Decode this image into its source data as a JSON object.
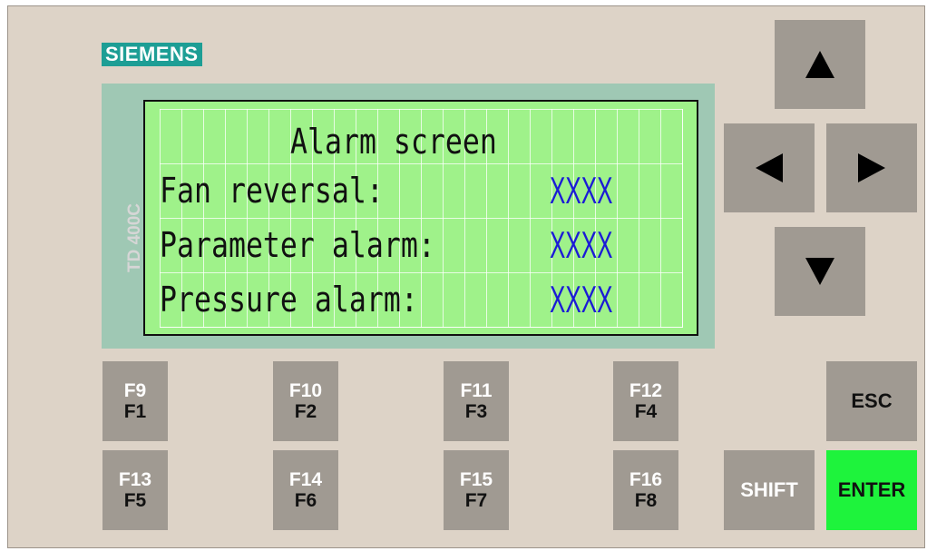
{
  "brand": "SIEMENS",
  "model": "TD 400C",
  "lcd": {
    "title": "Alarm screen",
    "rows": [
      {
        "label": "Fan reversal:",
        "value": "XXXX"
      },
      {
        "label": "Parameter alarm:",
        "value": "XXXX"
      },
      {
        "label": "Pressure alarm:",
        "value": "XXXX"
      }
    ],
    "colors": {
      "background": "#9ff28a",
      "value_text": "#1b1bd6"
    }
  },
  "function_keys": [
    {
      "top": "F9",
      "bottom": "F1"
    },
    {
      "top": "F10",
      "bottom": "F2"
    },
    {
      "top": "F11",
      "bottom": "F3"
    },
    {
      "top": "F12",
      "bottom": "F4"
    },
    {
      "top": "F13",
      "bottom": "F5"
    },
    {
      "top": "F14",
      "bottom": "F6"
    },
    {
      "top": "F15",
      "bottom": "F7"
    },
    {
      "top": "F16",
      "bottom": "F8"
    }
  ],
  "nav_keys": {
    "up": "arrow-up-icon",
    "left": "arrow-left-icon",
    "right": "arrow-right-icon",
    "down": "arrow-down-icon"
  },
  "control_keys": {
    "esc": "ESC",
    "shift": "SHIFT",
    "enter": "ENTER"
  },
  "colors": {
    "panel": "#ddd3c7",
    "key": "#a09a92",
    "enter_key": "#1ef33c",
    "brand_badge": "#1d9e95",
    "bezel": "#9fc8b4"
  }
}
